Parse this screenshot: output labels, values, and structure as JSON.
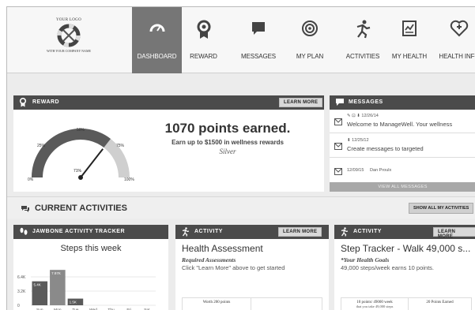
{
  "logo": {
    "top": "YOUR LOGO",
    "bottom": "WITH YOUR COMPANY NAME"
  },
  "nav": {
    "items": [
      {
        "label": "DASHBOARD",
        "icon": "gauge-icon"
      },
      {
        "label": "REWARD",
        "icon": "medal-icon"
      },
      {
        "label": "MESSAGES",
        "icon": "chat-icon"
      },
      {
        "label": "MY PLAN",
        "icon": "target-icon"
      },
      {
        "label": "ACTIVITIES",
        "icon": "runner-icon"
      },
      {
        "label": "MY HEALTH",
        "icon": "health-chart-icon"
      },
      {
        "label": "HEALTH INFO",
        "icon": "heart-shield-icon"
      }
    ]
  },
  "reward": {
    "header": "REWARD",
    "learn_more": "LEARN MORE",
    "points": "1070 points earned.",
    "subtitle": "Earn up to $1500 in wellness rewards",
    "tier": "Silver",
    "gauge": {
      "tick_0": "0%",
      "tick_25": "25%",
      "tick_50": "50%",
      "tick_75": "75%",
      "tick_100": "100%",
      "value_label": "71%",
      "value": 0.71
    }
  },
  "messages": {
    "header": "MESSAGES",
    "items": [
      {
        "meta": "✎ ⊡ ⬇ 12/26/14",
        "text": "Welcome to ManageWell. Your wellness"
      },
      {
        "meta": "⬇ 12/25/12",
        "text": "Create messages to targeted"
      },
      {
        "meta": "12/09/15     Dan Proulx",
        "text": ""
      }
    ],
    "view_all": "VIEW ALL MESSAGES"
  },
  "activities": {
    "header": "CURRENT ACTIVITIES",
    "show_all": "SHOW ALL MY ACTIVITIES"
  },
  "tracker": {
    "header": "JAWBONE ACTIVITY TRACKER",
    "title": "Steps this week",
    "yticks": [
      "6.4K",
      "3.2K",
      "0"
    ],
    "days": [
      "Sun",
      "Mon",
      "Tue",
      "Wed",
      "Thu",
      "Fri",
      "Sat"
    ],
    "values": [
      5400,
      7970,
      1500,
      0,
      0,
      0,
      0
    ],
    "labels": [
      "5.4K",
      "7.97K",
      "1.5K",
      "",
      "",
      "",
      ""
    ]
  },
  "activity1": {
    "header": "ACTIVITY",
    "learn_more": "LEARN MORE",
    "title": "Health Assessment",
    "sub": "Required Assessments",
    "desc": "Click \"Learn More\" above to get started",
    "foot": "Worth 200 points"
  },
  "activity2": {
    "header": "ACTIVITY",
    "learn_more": "LEARN MORE",
    "title": "Step Tracker - Walk 49,000 s...",
    "sub": "*Your Health Goals",
    "desc": "49,000 steps/week earns 10 points.",
    "foot1": "10 points/ 49000 week",
    "foot1b": "that you take 49,000 steps",
    "foot2": "20 Points Earned"
  }
}
